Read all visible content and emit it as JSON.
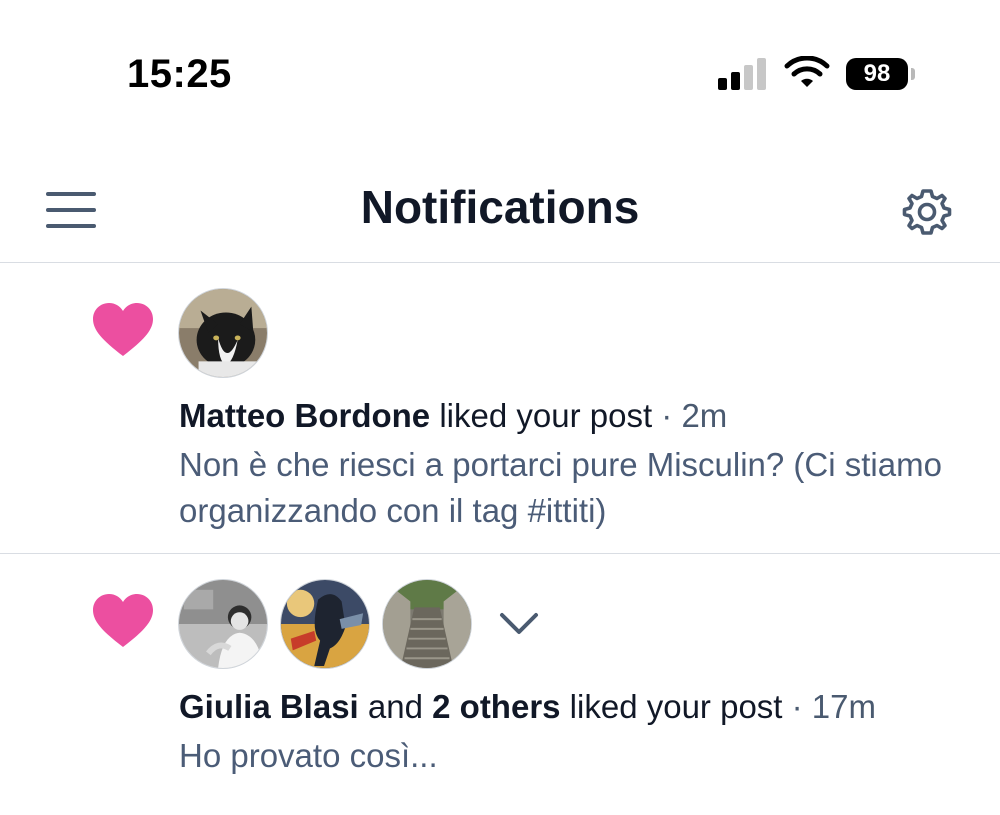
{
  "status_bar": {
    "time": "15:25",
    "battery_level": "98",
    "signal_bars_active": 2,
    "signal_bars_total": 4
  },
  "header": {
    "title": "Notifications",
    "menu_icon": "hamburger-menu-icon",
    "settings_icon": "gear-icon"
  },
  "notifications": [
    {
      "type_icon": "heart-icon",
      "actor_name": "Matteo Bordone",
      "action_text": " liked your post",
      "time": "2m",
      "excerpt": "Non è che riesci a portarci pure Misculin? (Ci stiamo organizzando con il tag #ittiti)"
    },
    {
      "type_icon": "heart-icon",
      "actor_name": "Giulia Blasi",
      "connector": " and ",
      "others": "2 others",
      "action_text": " liked your post",
      "time": "17m",
      "excerpt": "Ho provato così..."
    }
  ],
  "colors": {
    "heart": "#ec4fa0",
    "title": "#111827",
    "meta": "#4a5a70",
    "excerpt": "#4b5c77",
    "divider": "#d9dde3"
  }
}
